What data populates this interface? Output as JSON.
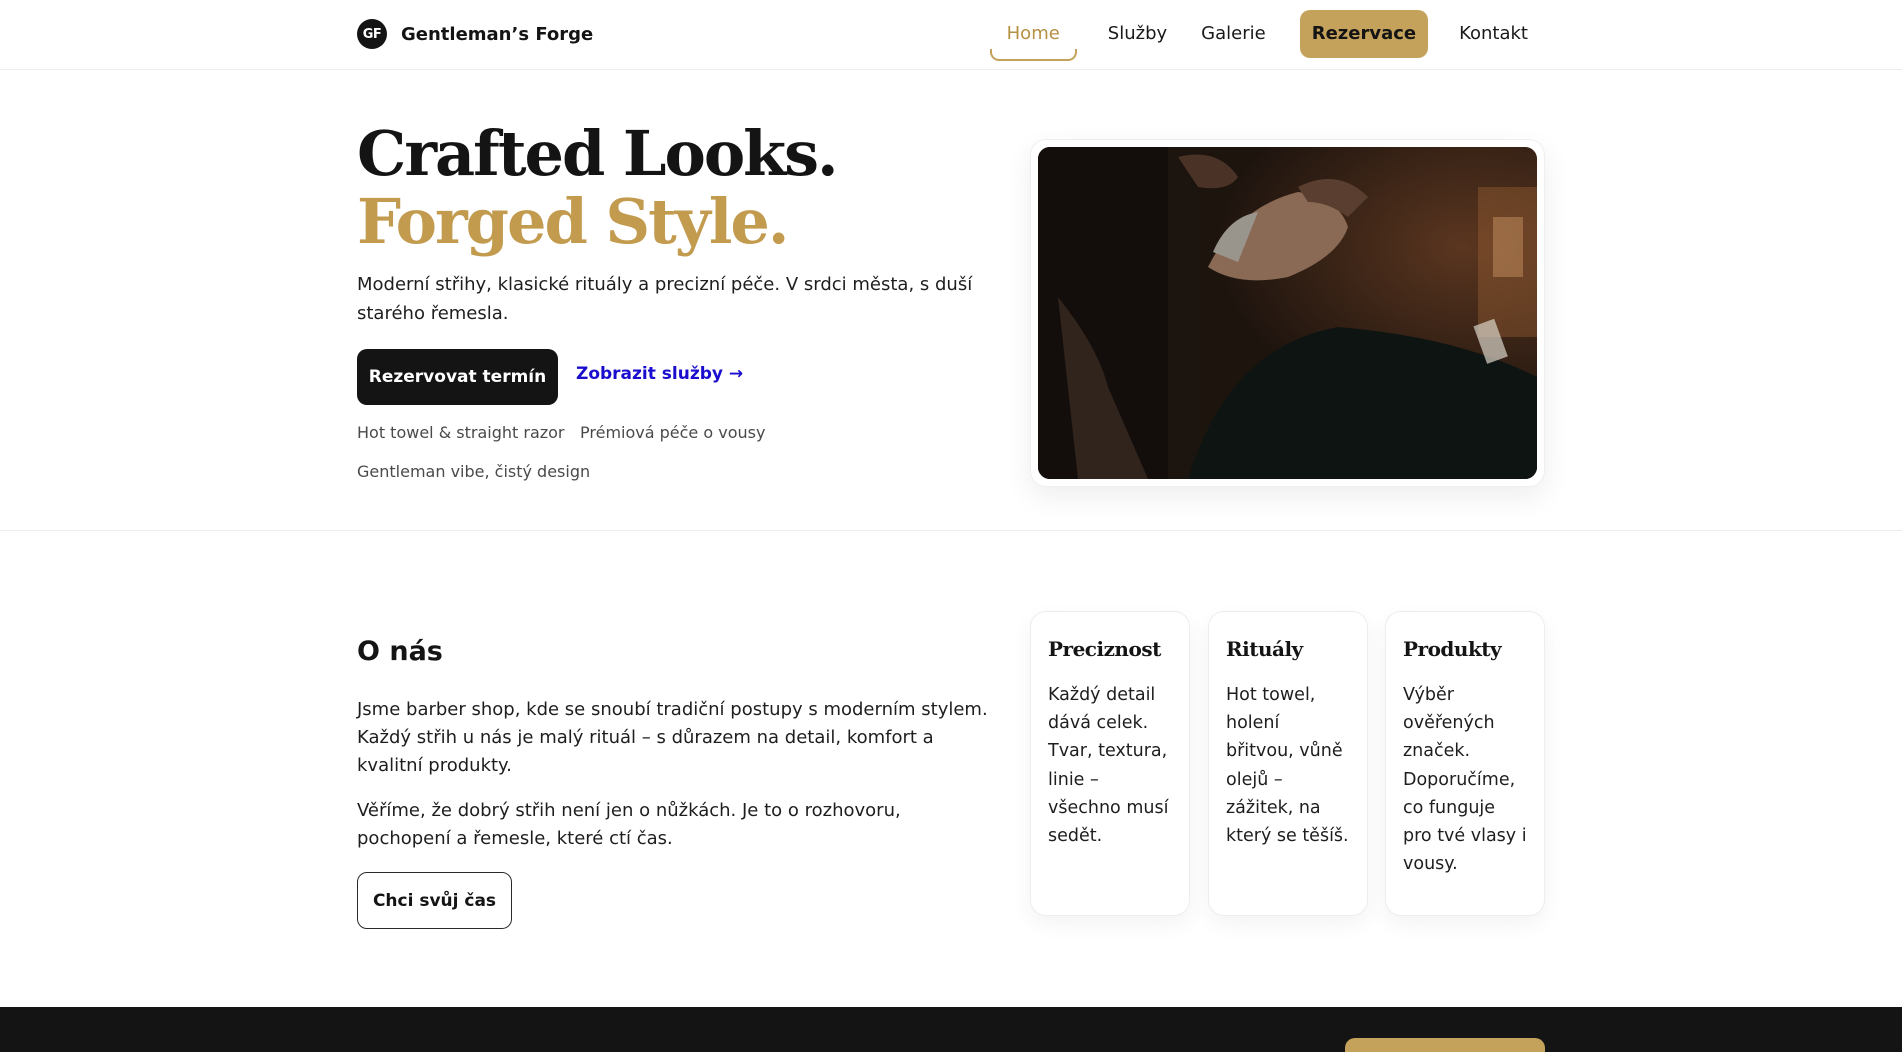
{
  "header": {
    "logo_text": "GF",
    "brand_name": "Gentleman’s Forge",
    "nav": [
      {
        "label": "Home",
        "active": true
      },
      {
        "label": "Služby"
      },
      {
        "label": "Galerie"
      },
      {
        "label": "Rezervace",
        "cta": true
      },
      {
        "label": "Kontakt"
      }
    ]
  },
  "hero": {
    "title_line1": "Crafted Looks.",
    "title_line2": "Forged Style.",
    "subtitle": "Moderní střihy, klasické rituály a precizní péče. V srdci města, s duší starého řemesla.",
    "primary_button": "Rezervovat termín",
    "secondary_link": "Zobrazit služby →",
    "tags": [
      "Hot towel & straight razor",
      "Prémiová péče o vousy",
      "Gentleman vibe, čistý design"
    ]
  },
  "about": {
    "title": "O nás",
    "paragraph1": "Jsme barber shop, kde se snoubí tradiční postupy s moderním stylem. Každý střih u nás je malý rituál – s důrazem na detail, komfort a kvalitní produkty.",
    "paragraph2": "Věříme, že dobrý střih není jen o nůžkách. Je to o rozhovoru, pochopení a řemesle, které ctí čas.",
    "button": "Chci svůj čas",
    "cards": [
      {
        "title": "Preciznost",
        "text": "Každý detail dává celek. Tvar, textura, linie – všechno musí sedět."
      },
      {
        "title": "Rituály",
        "text": "Hot towel, holení břitvou, vůně olejů – zážitek, na který se těšíš."
      },
      {
        "title": "Produkty",
        "text": "Výběr ověřených značek. Doporučíme, co funguje pro tvé vlasy i vousy."
      }
    ]
  },
  "colors": {
    "accent_gold": "#c4a25b",
    "dark": "#141414",
    "link_blue": "#1a0dce"
  }
}
